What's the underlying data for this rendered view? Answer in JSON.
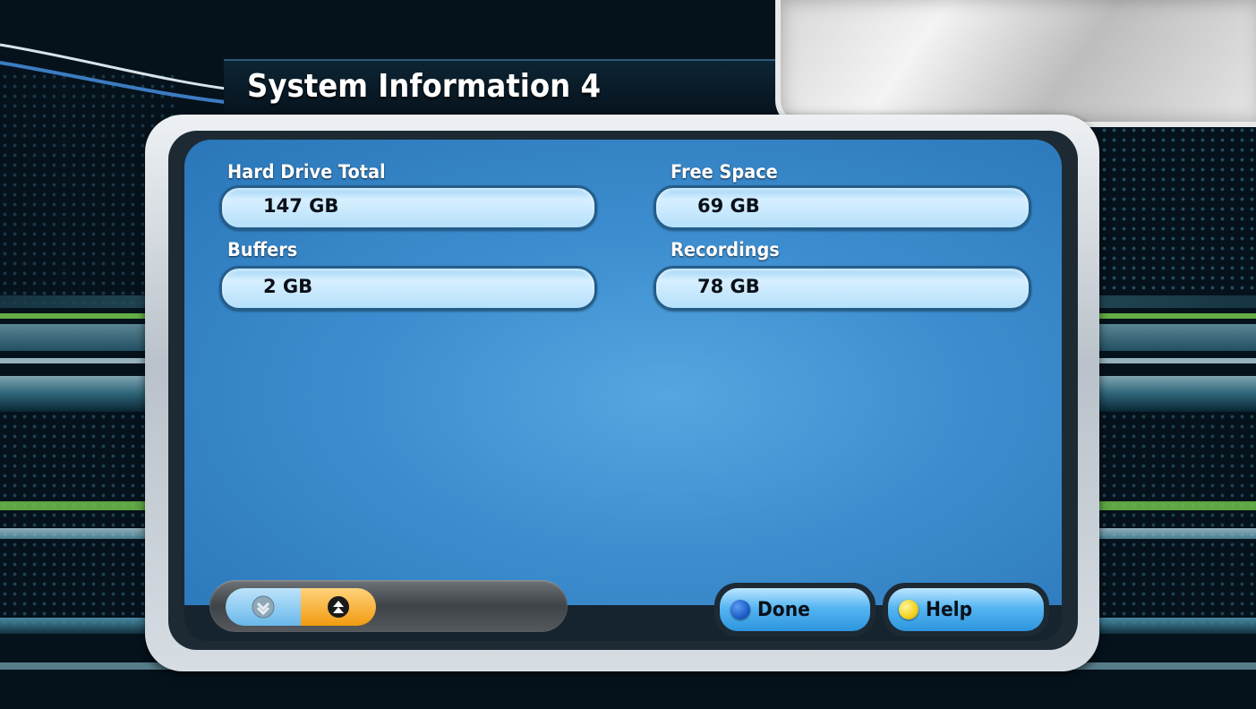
{
  "header": {
    "title": "System Information 4"
  },
  "fields": {
    "hard_drive_total": {
      "label": "Hard Drive Total",
      "value": "147 GB"
    },
    "free_space": {
      "label": "Free Space",
      "value": "69 GB"
    },
    "buffers": {
      "label": "Buffers",
      "value": "2 GB"
    },
    "recordings": {
      "label": "Recordings",
      "value": "78 GB"
    }
  },
  "footer": {
    "done_label": "Done",
    "help_label": "Help",
    "pager": {
      "down_icon": "page-down-icon",
      "up_icon": "page-up-icon"
    }
  },
  "colors": {
    "panel_blue": "#3c8dcf",
    "field_fill": "#c9e9fd",
    "done_dot": "#1e5fc8",
    "help_dot": "#f2d21b",
    "pager_active": "#f29b11"
  }
}
